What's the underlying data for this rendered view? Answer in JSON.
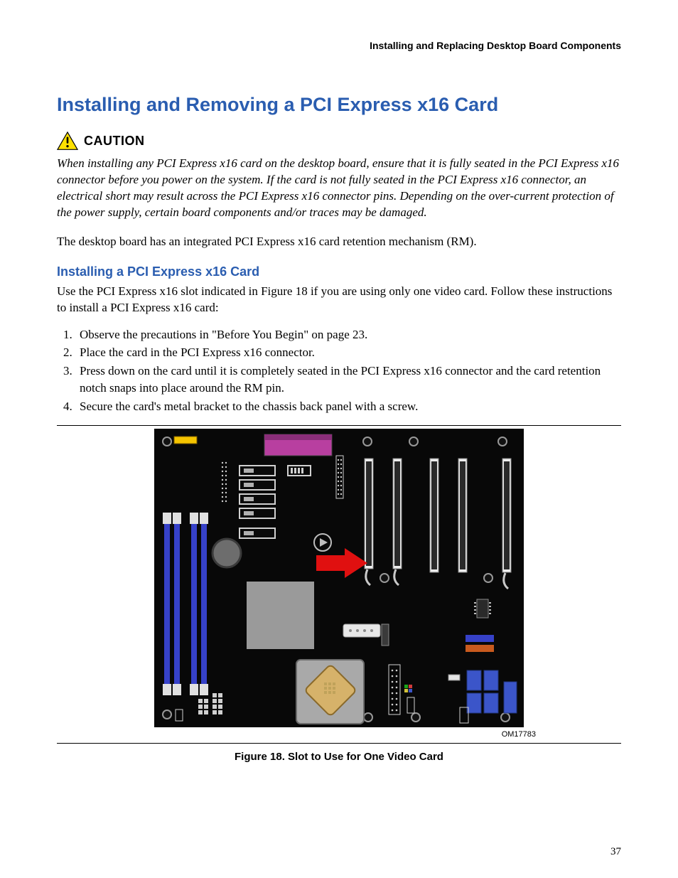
{
  "running_head": "Installing and Replacing Desktop Board Components",
  "section_title": "Installing and Removing a PCI Express x16 Card",
  "caution_label": "CAUTION",
  "caution_text": "When installing any PCI Express x16 card on the desktop board, ensure that it is fully seated in the PCI Express x16 connector before you power on the system.  If the card is not fully seated in the PCI Express x16 connector, an electrical short may result across the PCI Express x16 connector pins.  Depending on the over-current protection of the power supply, certain board components and/or traces may be damaged.",
  "intro_body": "The desktop board has an integrated PCI Express x16 card retention mechanism (RM).",
  "sub_title": "Installing a PCI Express x16 Card",
  "sub_intro": "Use the PCI Express x16 slot indicated in Figure 18 if you are using only one video card.  Follow these instructions to install a PCI Express x16 card:",
  "steps": [
    "Observe the precautions in \"Before You Begin\" on page 23.",
    "Place the card in the PCI Express x16 connector.",
    "Press down on the card until it is completely seated in the PCI Express x16 connector and the card retention notch snaps into place around the RM pin.",
    "Secure the card's metal bracket to the chassis back panel with a screw."
  ],
  "om_code": "OM17783",
  "figure_caption": "Figure 18.  Slot to Use for One Video Card",
  "page_number": "37"
}
